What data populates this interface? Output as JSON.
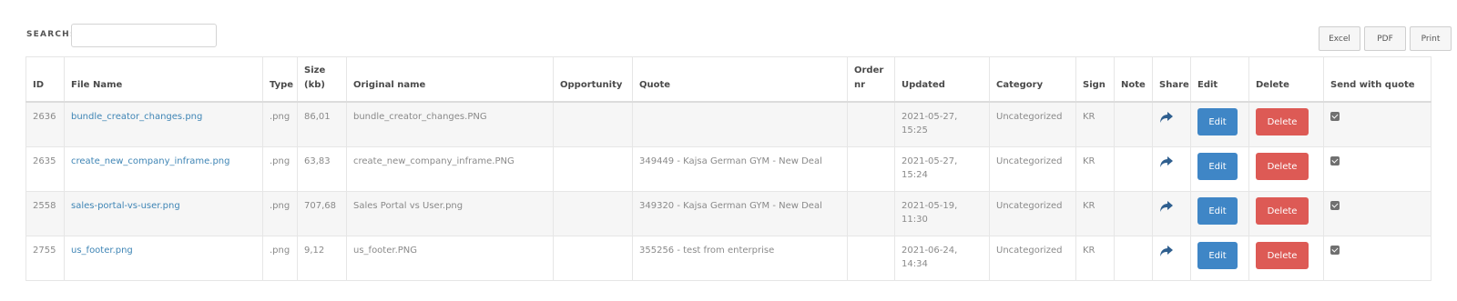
{
  "search": {
    "label": "SEARCH:",
    "value": "",
    "placeholder": ""
  },
  "export": {
    "excel": "Excel",
    "pdf": "PDF",
    "print": "Print"
  },
  "headers": {
    "id": "ID",
    "file_name": "File Name",
    "type": "Type",
    "size": "Size (kb)",
    "original_name": "Original name",
    "opportunity": "Opportunity",
    "quote": "Quote",
    "order_nr": "Order nr",
    "updated": "Updated",
    "category": "Category",
    "sign": "Sign",
    "note": "Note",
    "share": "Share",
    "edit": "Edit",
    "delete": "Delete",
    "send_with_quote": "Send with quote"
  },
  "rows": [
    {
      "id": "2636",
      "file_name": "bundle_creator_changes.png",
      "type": ".png",
      "size": "86,01",
      "original_name": "bundle_creator_changes.PNG",
      "opportunity": "",
      "quote": "",
      "order_nr": "",
      "updated": "2021-05-27, 15:25",
      "category": "Uncategorized",
      "sign": "KR",
      "note": "",
      "edit_label": "Edit",
      "delete_label": "Delete",
      "send_with_quote": true
    },
    {
      "id": "2635",
      "file_name": "create_new_company_inframe.png",
      "type": ".png",
      "size": "63,83",
      "original_name": "create_new_company_inframe.PNG",
      "opportunity": "",
      "quote": "349449 - Kajsa German GYM - New Deal",
      "order_nr": "",
      "updated": "2021-05-27, 15:24",
      "category": "Uncategorized",
      "sign": "KR",
      "note": "",
      "edit_label": "Edit",
      "delete_label": "Delete",
      "send_with_quote": true
    },
    {
      "id": "2558",
      "file_name": "sales-portal-vs-user.png",
      "type": ".png",
      "size": "707,68",
      "original_name": "Sales Portal vs User.png",
      "opportunity": "",
      "quote": "349320 - Kajsa German GYM - New Deal",
      "order_nr": "",
      "updated": "2021-05-19, 11:30",
      "category": "Uncategorized",
      "sign": "KR",
      "note": "",
      "edit_label": "Edit",
      "delete_label": "Delete",
      "send_with_quote": true
    },
    {
      "id": "2755",
      "file_name": "us_footer.png",
      "type": ".png",
      "size": "9,12",
      "original_name": "us_footer.PNG",
      "opportunity": "",
      "quote": "355256 - test from enterprise",
      "order_nr": "",
      "updated": "2021-06-24, 14:34",
      "category": "Uncategorized",
      "sign": "KR",
      "note": "",
      "edit_label": "Edit",
      "delete_label": "Delete",
      "send_with_quote": true
    }
  ],
  "icons": {
    "share": "share-arrow-icon",
    "checkbox": "checkbox-checked-icon"
  },
  "colors": {
    "edit": "#3f86c6",
    "delete": "#dd5a55",
    "link": "#3f85b5",
    "row_alt": "#f6f6f6"
  }
}
